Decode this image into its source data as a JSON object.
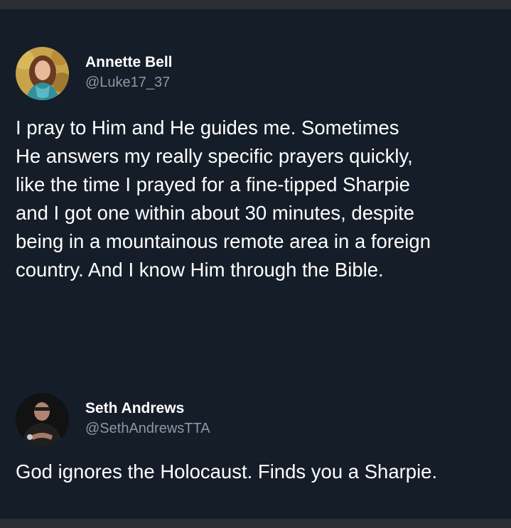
{
  "tweets": [
    {
      "author_name": "Annette Bell",
      "handle": "@Luke17_37",
      "avatar_icon": "profile-photo-woman-icon",
      "lines": [
        "I pray to Him and He guides me. Sometimes",
        "He answers my really specific prayers quickly,",
        "like the time I prayed for a fine-tipped Sharpie",
        "and I got one within about 30 minutes, despite",
        "being in a mountainous remote area in a foreign",
        "country. And I know Him through the Bible."
      ]
    },
    {
      "author_name": "Seth Andrews",
      "handle": "@SethAndrewsTTA",
      "avatar_icon": "profile-photo-man-icon",
      "lines": [
        "God ignores the Holocaust. Finds you a Sharpie."
      ]
    }
  ],
  "colors": {
    "background": "#151d28",
    "text": "#ffffff",
    "secondary_text": "#8b98a5",
    "frame": "#2b2d31"
  }
}
